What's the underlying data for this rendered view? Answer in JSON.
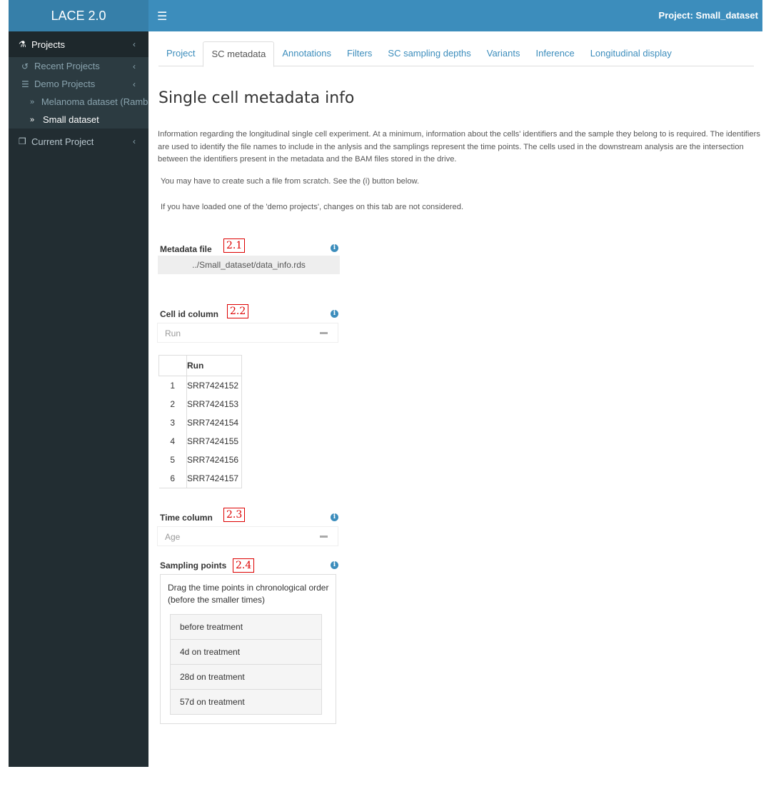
{
  "app": {
    "title": "LACE 2.0"
  },
  "header": {
    "menu_icon": "hamburger-icon",
    "project_label": "Project: Small_dataset"
  },
  "sidebar": {
    "projects": {
      "label": "Projects"
    },
    "recent": {
      "label": "Recent Projects"
    },
    "demo": {
      "label": "Demo Projects"
    },
    "demo_items": [
      {
        "label": "Melanoma dataset (Rambow)"
      },
      {
        "label": "Small dataset"
      }
    ],
    "current": {
      "label": "Current Project"
    }
  },
  "tabs": [
    {
      "label": "Project"
    },
    {
      "label": "SC metadata"
    },
    {
      "label": "Annotations"
    },
    {
      "label": "Filters"
    },
    {
      "label": "SC sampling depths"
    },
    {
      "label": "Variants"
    },
    {
      "label": "Inference"
    },
    {
      "label": "Longitudinal display"
    }
  ],
  "main": {
    "title": "Single cell metadata info",
    "description": "Information regarding the longitudinal single cell experiment. At a minimum, information about the cells' identifiers and the sample they belong to is required. The identifiers are used to identify the file names to include in the anlysis and the samplings represent the time points. The cells used in the downstream analysis are the intersection between the identifiers present in the metadata and the BAM files stored in the drive.",
    "note1": "You may have to create such a file from scratch. See the (i) button below.",
    "note2": "If you have loaded one of the 'demo projects', changes on this tab are not considered."
  },
  "metadata_file": {
    "label": "Metadata file",
    "tag": "2.1",
    "value": "../Small_dataset/data_info.rds"
  },
  "cell_id": {
    "label": "Cell id column",
    "tag": "2.2",
    "value": "Run"
  },
  "table": {
    "header": "Run",
    "rows": [
      {
        "idx": "1",
        "value": "SRR7424152"
      },
      {
        "idx": "2",
        "value": "SRR7424153"
      },
      {
        "idx": "3",
        "value": "SRR7424154"
      },
      {
        "idx": "4",
        "value": "SRR7424155"
      },
      {
        "idx": "5",
        "value": "SRR7424156"
      },
      {
        "idx": "6",
        "value": "SRR7424157"
      }
    ]
  },
  "time": {
    "label": "Time column",
    "tag": "2.3",
    "value": "Age"
  },
  "sampling": {
    "label": "Sampling points",
    "tag": "2.4",
    "help": "Drag the time points in chronological order (before the smaller times)",
    "items": [
      {
        "label": "before treatment"
      },
      {
        "label": "4d on treatment"
      },
      {
        "label": "28d on treatment"
      },
      {
        "label": "57d on treatment"
      }
    ]
  },
  "colors": {
    "header": "#3c8dbc",
    "logo": "#367fa9",
    "sidebar": "#222d32",
    "annotation_tag": "#dd0000"
  }
}
